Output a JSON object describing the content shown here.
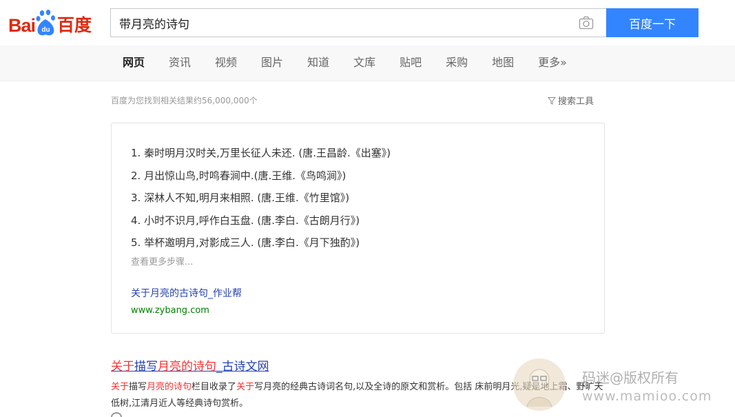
{
  "header": {
    "logo_bai": "Bai",
    "logo_du": "百度",
    "search_value": "带月亮的诗句",
    "search_button": "百度一下",
    "camera_icon": "camera-icon"
  },
  "tabs": [
    {
      "label": "网页",
      "active": true
    },
    {
      "label": "资讯"
    },
    {
      "label": "视频"
    },
    {
      "label": "图片"
    },
    {
      "label": "知道"
    },
    {
      "label": "文库"
    },
    {
      "label": "贴吧"
    },
    {
      "label": "采购"
    },
    {
      "label": "地图"
    },
    {
      "label": "更多»"
    }
  ],
  "results_info": {
    "count_text": "百度为您找到相关结果约56,000,000个",
    "tools_label": "搜索工具"
  },
  "answer_card": {
    "poems": [
      "1. 秦时明月汉时关,万里长征人未还. (唐.王昌龄.《出塞》)",
      "2. 月出惊山鸟,时鸣春涧中.(唐.王维.《鸟鸣涧》)",
      "3. 深林人不知,明月来相照. (唐.王维.《竹里馆》)",
      "4. 小时不识月,呼作白玉盘. (唐.李白.《古朗月行》)",
      "5. 举杯邀明月,对影成三人. (唐.李白.《月下独酌》)"
    ],
    "see_more": "查看更多步骤...",
    "source_title": "关于月亮的古诗句_作业帮",
    "source_url": "www.zybang.com"
  },
  "result2": {
    "title_parts": [
      "关于",
      "描写",
      "月亮的诗句",
      "_古诗文网"
    ],
    "snippet_parts": [
      "关于",
      "描写",
      "月亮的诗句",
      "栏目收录了",
      "关于",
      "写月亮的经典古诗词名句,以及全诗的原文和赏析。包括 床前明月光,疑是地上霜、野旷天低树,江清月近人等经典诗句赏析。"
    ]
  },
  "watermark": {
    "line1": "码迷@版权所有",
    "line2": "www.mamioo.com"
  },
  "colors": {
    "brand_red": "#de2910",
    "brand_blue": "#3385ff",
    "link_blue": "#2440b3",
    "highlight_red": "#f73131",
    "url_green": "#008000"
  }
}
